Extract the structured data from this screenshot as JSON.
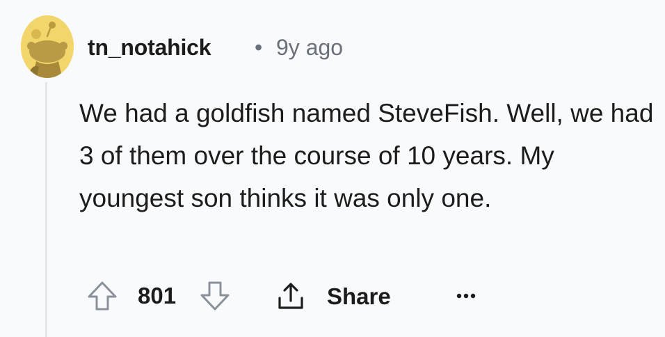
{
  "comment": {
    "author": "tn_notahick",
    "separator": "•",
    "timestamp": "9y ago",
    "body": "We had a goldfish named SteveFish. Well, we had 3 of them over the course of 10 years. My youngest son thinks it was only one.",
    "avatar_icon": "snoo-avatar-icon",
    "avatar_color": "#f3d66b"
  },
  "actions": {
    "upvote_icon": "upvote-arrow-icon",
    "vote_count": "801",
    "downvote_icon": "downvote-arrow-icon",
    "share_icon": "share-upload-icon",
    "share_label": "Share",
    "more_icon": "ellipsis-icon"
  }
}
